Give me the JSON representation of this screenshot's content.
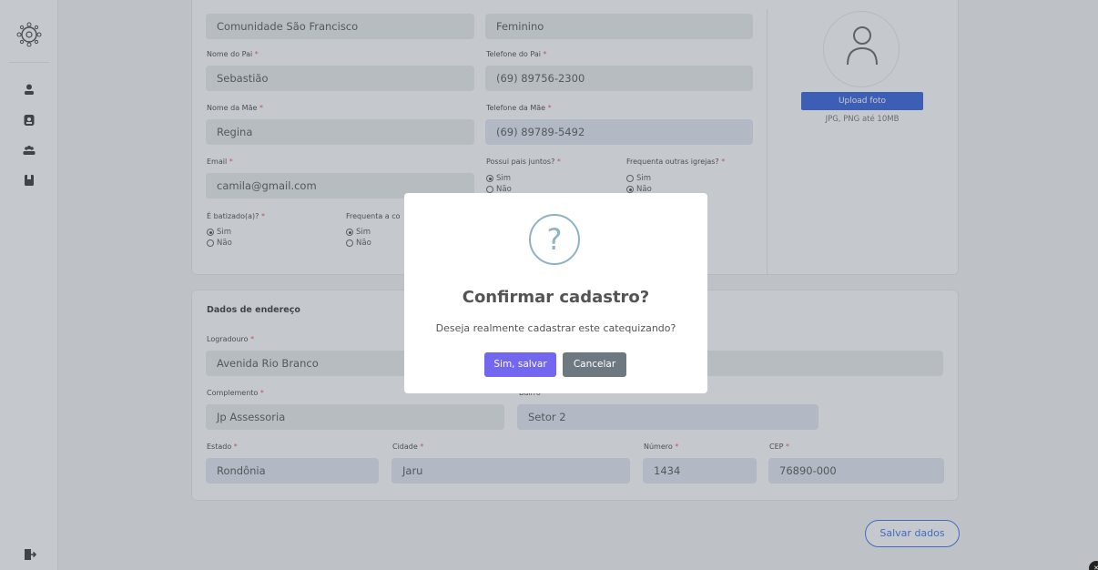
{
  "sidebar": {
    "icons": [
      "logo-icon",
      "user-icon",
      "badge-icon",
      "group-icon",
      "book-icon",
      "logout-icon"
    ]
  },
  "personal": {
    "community_value": "Comunidade São Francisco",
    "gender_value": "Feminino",
    "father_name_label": "Nome do Pai",
    "father_name_value": "Sebastião",
    "father_phone_label": "Telefone do Pai",
    "father_phone_value": "(69) 89756-2300",
    "mother_name_label": "Nome da Mãe",
    "mother_name_value": "Regina",
    "mother_phone_label": "Telefone da Mãe",
    "mother_phone_value": "(69) 89789-5492",
    "email_label": "Email",
    "email_value": "camila@gmail.com",
    "parents_together_label": "Possui pais juntos?",
    "other_churches_label": "Frequenta outras igrejas?",
    "baptized_label": "É batizado(a)?",
    "attends_label": "Frequenta a co",
    "yes": "Sim",
    "no": "Não",
    "required_mark": "*"
  },
  "photo": {
    "upload_label": "Upload foto",
    "hint": "JPG, PNG até 10MB"
  },
  "address": {
    "section_title": "Dados de endereço",
    "street_label": "Logradouro",
    "street_value": "Avenida Rio Branco",
    "complement_label": "Complemento",
    "complement_value": "Jp Assessoria",
    "neighborhood_label": "Bairro",
    "neighborhood_value": "Setor 2",
    "state_label": "Estado",
    "state_value": "Rondônia",
    "city_label": "Cidade",
    "city_value": "Jaru",
    "number_label": "Número",
    "number_value": "1434",
    "cep_label": "CEP",
    "cep_value": "76890-000"
  },
  "save_data_label": "Salvar dados",
  "modal": {
    "icon": "question-icon",
    "icon_glyph": "?",
    "title": "Confirmar cadastro?",
    "text": "Deseja realmente cadastrar este catequizando?",
    "confirm_label": "Sim, salvar",
    "cancel_label": "Cancelar"
  },
  "colors": {
    "accent": "#7367f0",
    "primary": "#1d4ed8",
    "cancel": "#6e7881",
    "required": "#ef4444"
  }
}
